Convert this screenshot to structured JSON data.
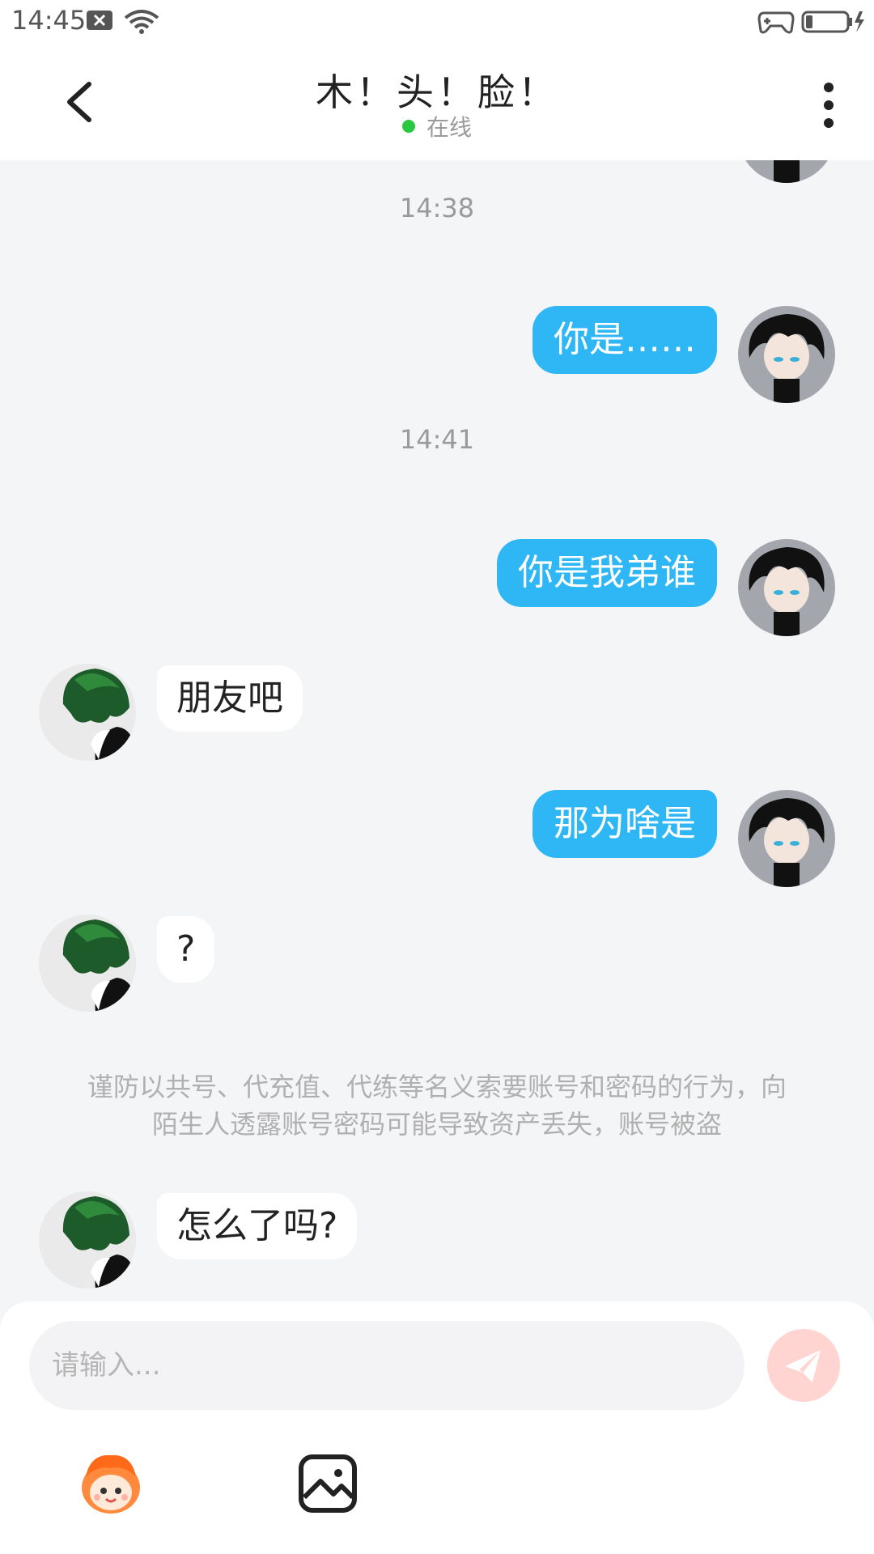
{
  "status_bar": {
    "time": "14:45"
  },
  "header": {
    "title": "木！头！脸！",
    "status": "在线"
  },
  "messages": [
    {
      "time": "14:38"
    },
    {
      "text": "你是……"
    },
    {
      "time": "14:41"
    },
    {
      "text": "你是我弟谁"
    },
    {
      "text": "朋友吧"
    },
    {
      "text": "那为啥是"
    },
    {
      "text": "?"
    },
    {
      "notice": "谨防以共号、代充值、代练等名义索要账号和密码的行为，向陌生人透露账号密码可能导致资产丢失，账号被盗"
    },
    {
      "text": "怎么了吗?"
    }
  ],
  "composer": {
    "placeholder": "请输入..."
  },
  "colors": {
    "accent": "#2fb7f5",
    "online": "#28c840",
    "send_disabled": "#ffd4d1"
  },
  "icons": [
    "back-arrow-icon",
    "more-vertical-icon",
    "send-icon",
    "emoji-mascot-icon",
    "image-icon"
  ]
}
